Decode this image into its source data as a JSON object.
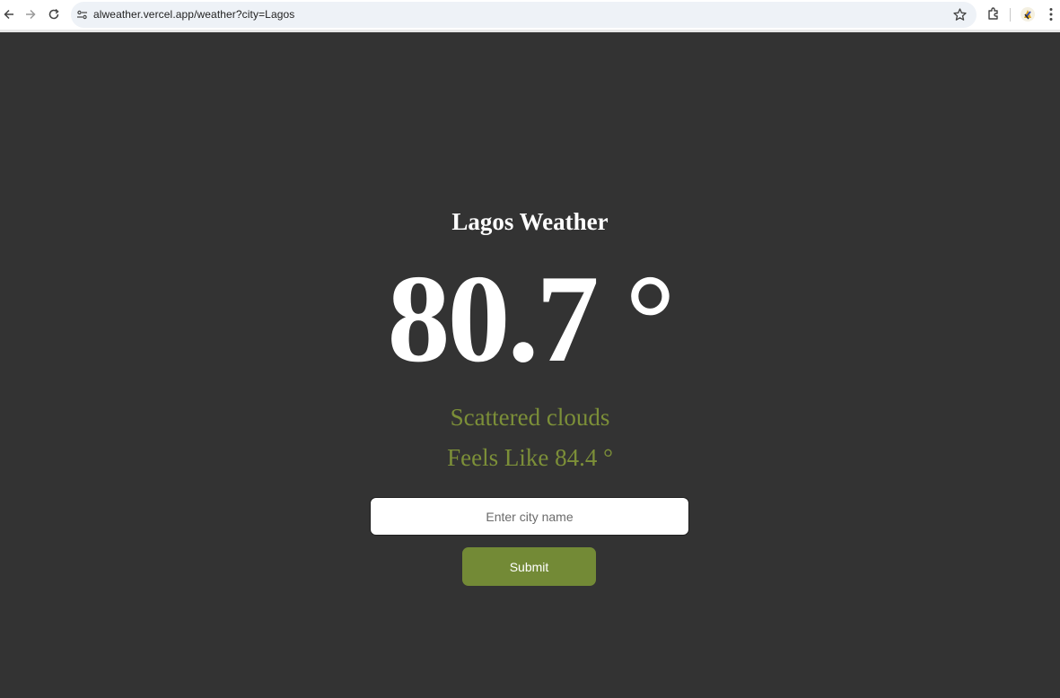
{
  "browser": {
    "url": "alweather.vercel.app/weather?city=Lagos",
    "icons": [
      "back-arrow-icon",
      "forward-arrow-icon",
      "reload-icon",
      "site-info-icon",
      "bookmark-star-icon",
      "extensions-icon",
      "profile-avatar-icon",
      "more-menu-icon"
    ]
  },
  "weather": {
    "title": "Lagos Weather",
    "temperature": "80.7 °",
    "description": "Scattered clouds",
    "feels_like": "Feels Like 84.4 °"
  },
  "form": {
    "city_placeholder": "Enter city name",
    "city_value": "",
    "submit_label": "Submit"
  },
  "colors": {
    "background": "#333333",
    "accent_text": "#7c8f38",
    "button": "#738a36"
  }
}
